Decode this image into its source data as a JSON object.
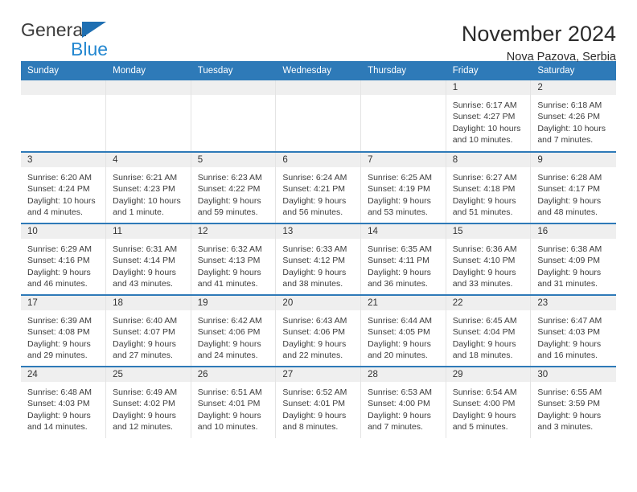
{
  "brand": {
    "word_one": "General",
    "word_two": "Blue",
    "triangle_icon": "blue-triangle-logo-mark",
    "accent_blue": "#2387d0",
    "logo_blue": "#1f6fb2"
  },
  "header": {
    "title": "November 2024",
    "subtitle": "Nova Pazova, Serbia"
  },
  "theme": {
    "header_bar": "#2e7ab8",
    "daynum_band": "#efefef",
    "row_rule": "#2e7ab8",
    "text": "#3c3c3c"
  },
  "weekday_headers": [
    "Sunday",
    "Monday",
    "Tuesday",
    "Wednesday",
    "Thursday",
    "Friday",
    "Saturday"
  ],
  "weeks": [
    [
      {
        "day": "",
        "empty": true,
        "lines": []
      },
      {
        "day": "",
        "empty": true,
        "lines": []
      },
      {
        "day": "",
        "empty": true,
        "lines": []
      },
      {
        "day": "",
        "empty": true,
        "lines": []
      },
      {
        "day": "",
        "empty": true,
        "lines": []
      },
      {
        "day": "1",
        "empty": false,
        "lines": [
          "Sunrise: 6:17 AM",
          "Sunset: 4:27 PM",
          "Daylight: 10 hours",
          "and 10 minutes."
        ]
      },
      {
        "day": "2",
        "empty": false,
        "lines": [
          "Sunrise: 6:18 AM",
          "Sunset: 4:26 PM",
          "Daylight: 10 hours",
          "and 7 minutes."
        ]
      }
    ],
    [
      {
        "day": "3",
        "empty": false,
        "lines": [
          "Sunrise: 6:20 AM",
          "Sunset: 4:24 PM",
          "Daylight: 10 hours",
          "and 4 minutes."
        ]
      },
      {
        "day": "4",
        "empty": false,
        "lines": [
          "Sunrise: 6:21 AM",
          "Sunset: 4:23 PM",
          "Daylight: 10 hours",
          "and 1 minute."
        ]
      },
      {
        "day": "5",
        "empty": false,
        "lines": [
          "Sunrise: 6:23 AM",
          "Sunset: 4:22 PM",
          "Daylight: 9 hours",
          "and 59 minutes."
        ]
      },
      {
        "day": "6",
        "empty": false,
        "lines": [
          "Sunrise: 6:24 AM",
          "Sunset: 4:21 PM",
          "Daylight: 9 hours",
          "and 56 minutes."
        ]
      },
      {
        "day": "7",
        "empty": false,
        "lines": [
          "Sunrise: 6:25 AM",
          "Sunset: 4:19 PM",
          "Daylight: 9 hours",
          "and 53 minutes."
        ]
      },
      {
        "day": "8",
        "empty": false,
        "lines": [
          "Sunrise: 6:27 AM",
          "Sunset: 4:18 PM",
          "Daylight: 9 hours",
          "and 51 minutes."
        ]
      },
      {
        "day": "9",
        "empty": false,
        "lines": [
          "Sunrise: 6:28 AM",
          "Sunset: 4:17 PM",
          "Daylight: 9 hours",
          "and 48 minutes."
        ]
      }
    ],
    [
      {
        "day": "10",
        "empty": false,
        "lines": [
          "Sunrise: 6:29 AM",
          "Sunset: 4:16 PM",
          "Daylight: 9 hours",
          "and 46 minutes."
        ]
      },
      {
        "day": "11",
        "empty": false,
        "lines": [
          "Sunrise: 6:31 AM",
          "Sunset: 4:14 PM",
          "Daylight: 9 hours",
          "and 43 minutes."
        ]
      },
      {
        "day": "12",
        "empty": false,
        "lines": [
          "Sunrise: 6:32 AM",
          "Sunset: 4:13 PM",
          "Daylight: 9 hours",
          "and 41 minutes."
        ]
      },
      {
        "day": "13",
        "empty": false,
        "lines": [
          "Sunrise: 6:33 AM",
          "Sunset: 4:12 PM",
          "Daylight: 9 hours",
          "and 38 minutes."
        ]
      },
      {
        "day": "14",
        "empty": false,
        "lines": [
          "Sunrise: 6:35 AM",
          "Sunset: 4:11 PM",
          "Daylight: 9 hours",
          "and 36 minutes."
        ]
      },
      {
        "day": "15",
        "empty": false,
        "lines": [
          "Sunrise: 6:36 AM",
          "Sunset: 4:10 PM",
          "Daylight: 9 hours",
          "and 33 minutes."
        ]
      },
      {
        "day": "16",
        "empty": false,
        "lines": [
          "Sunrise: 6:38 AM",
          "Sunset: 4:09 PM",
          "Daylight: 9 hours",
          "and 31 minutes."
        ]
      }
    ],
    [
      {
        "day": "17",
        "empty": false,
        "lines": [
          "Sunrise: 6:39 AM",
          "Sunset: 4:08 PM",
          "Daylight: 9 hours",
          "and 29 minutes."
        ]
      },
      {
        "day": "18",
        "empty": false,
        "lines": [
          "Sunrise: 6:40 AM",
          "Sunset: 4:07 PM",
          "Daylight: 9 hours",
          "and 27 minutes."
        ]
      },
      {
        "day": "19",
        "empty": false,
        "lines": [
          "Sunrise: 6:42 AM",
          "Sunset: 4:06 PM",
          "Daylight: 9 hours",
          "and 24 minutes."
        ]
      },
      {
        "day": "20",
        "empty": false,
        "lines": [
          "Sunrise: 6:43 AM",
          "Sunset: 4:06 PM",
          "Daylight: 9 hours",
          "and 22 minutes."
        ]
      },
      {
        "day": "21",
        "empty": false,
        "lines": [
          "Sunrise: 6:44 AM",
          "Sunset: 4:05 PM",
          "Daylight: 9 hours",
          "and 20 minutes."
        ]
      },
      {
        "day": "22",
        "empty": false,
        "lines": [
          "Sunrise: 6:45 AM",
          "Sunset: 4:04 PM",
          "Daylight: 9 hours",
          "and 18 minutes."
        ]
      },
      {
        "day": "23",
        "empty": false,
        "lines": [
          "Sunrise: 6:47 AM",
          "Sunset: 4:03 PM",
          "Daylight: 9 hours",
          "and 16 minutes."
        ]
      }
    ],
    [
      {
        "day": "24",
        "empty": false,
        "lines": [
          "Sunrise: 6:48 AM",
          "Sunset: 4:03 PM",
          "Daylight: 9 hours",
          "and 14 minutes."
        ]
      },
      {
        "day": "25",
        "empty": false,
        "lines": [
          "Sunrise: 6:49 AM",
          "Sunset: 4:02 PM",
          "Daylight: 9 hours",
          "and 12 minutes."
        ]
      },
      {
        "day": "26",
        "empty": false,
        "lines": [
          "Sunrise: 6:51 AM",
          "Sunset: 4:01 PM",
          "Daylight: 9 hours",
          "and 10 minutes."
        ]
      },
      {
        "day": "27",
        "empty": false,
        "lines": [
          "Sunrise: 6:52 AM",
          "Sunset: 4:01 PM",
          "Daylight: 9 hours",
          "and 8 minutes."
        ]
      },
      {
        "day": "28",
        "empty": false,
        "lines": [
          "Sunrise: 6:53 AM",
          "Sunset: 4:00 PM",
          "Daylight: 9 hours",
          "and 7 minutes."
        ]
      },
      {
        "day": "29",
        "empty": false,
        "lines": [
          "Sunrise: 6:54 AM",
          "Sunset: 4:00 PM",
          "Daylight: 9 hours",
          "and 5 minutes."
        ]
      },
      {
        "day": "30",
        "empty": false,
        "lines": [
          "Sunrise: 6:55 AM",
          "Sunset: 3:59 PM",
          "Daylight: 9 hours",
          "and 3 minutes."
        ]
      }
    ]
  ]
}
